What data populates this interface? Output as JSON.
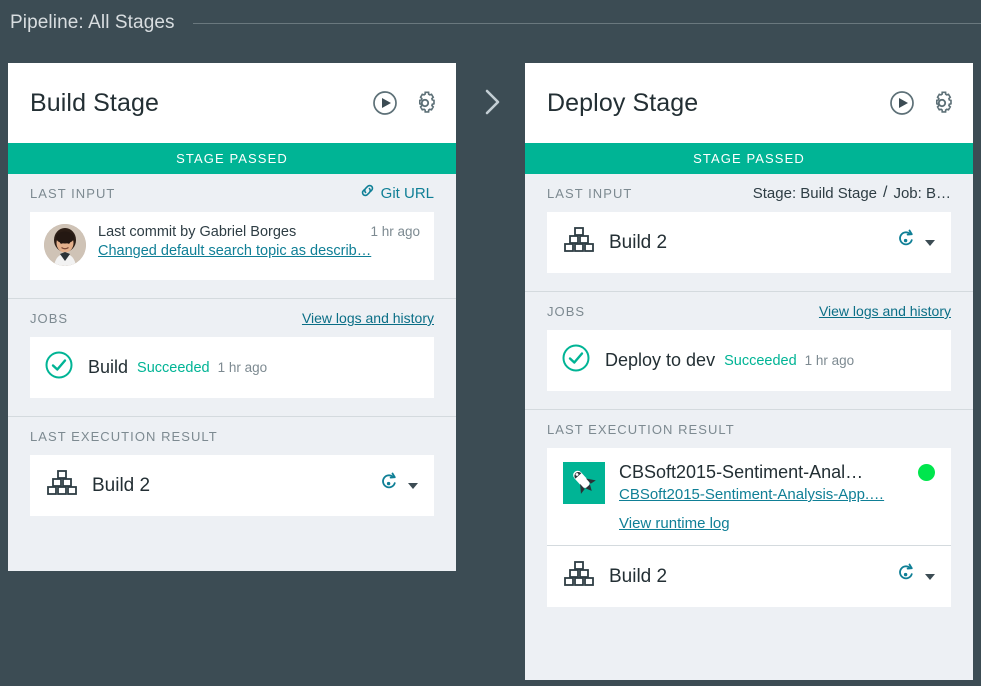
{
  "header": {
    "title": "Pipeline: All Stages"
  },
  "colors": {
    "background": "#3c4c54",
    "card_background": "#edf0f4",
    "status_green": "#00b495",
    "link_teal": "#0f7f96",
    "app_running_dot": "#00e64d",
    "text_dark": "#232f34",
    "text_muted": "#7d8a91"
  },
  "stages": [
    {
      "title": "Build Stage",
      "run_icon": "play-circle-icon",
      "settings_icon": "gear-icon",
      "status": "STAGE PASSED",
      "last_input": {
        "label": "LAST INPUT",
        "link_label": "Git URL",
        "link_icon": "link-chain-icon",
        "commit": {
          "author_line": "Last commit by Gabriel Borges",
          "time": "1 hr ago",
          "message": "Changed default search topic as describ…",
          "avatar": "user-avatar"
        }
      },
      "jobs": {
        "label": "JOBS",
        "link_label": "View logs and history",
        "items": [
          {
            "name": "Build",
            "status": "Succeeded",
            "time": "1 hr ago",
            "icon": "check-circle-icon"
          }
        ]
      },
      "last_execution_result": {
        "label": "LAST EXECUTION RESULT",
        "artifacts": [
          {
            "name": "Build 2",
            "icon": "build-blocks-icon",
            "action_icon": "rerun-circular-arrow-icon",
            "caret_icon": "caret-down-icon"
          }
        ]
      }
    },
    {
      "title": "Deploy Stage",
      "run_icon": "play-circle-icon",
      "settings_icon": "gear-icon",
      "status": "STAGE PASSED",
      "last_input": {
        "label": "LAST INPUT",
        "breadcrumb_stage": "Stage: Build Stage",
        "breadcrumb_separator": "/",
        "breadcrumb_job": "Job: B…",
        "artifact": {
          "name": "Build 2",
          "icon": "build-blocks-icon",
          "action_icon": "rerun-circular-arrow-icon",
          "caret_icon": "caret-down-icon"
        }
      },
      "jobs": {
        "label": "JOBS",
        "link_label": "View logs and history",
        "items": [
          {
            "name": "Deploy to dev",
            "status": "Succeeded",
            "time": "1 hr ago",
            "icon": "check-circle-icon"
          }
        ]
      },
      "last_execution_result": {
        "label": "LAST EXECUTION RESULT",
        "app": {
          "title": "CBSoft2015-Sentiment-Anal…",
          "url": "CBSoft2015-Sentiment-Analysis-App.…",
          "log_link": "View runtime log",
          "icon": "rocket-app-icon",
          "status_dot": "running-green-dot"
        },
        "artifacts": [
          {
            "name": "Build 2",
            "icon": "build-blocks-icon",
            "action_icon": "rerun-circular-arrow-icon",
            "caret_icon": "caret-down-icon"
          }
        ]
      }
    }
  ],
  "stage_arrow_icon": "chevron-right-icon"
}
